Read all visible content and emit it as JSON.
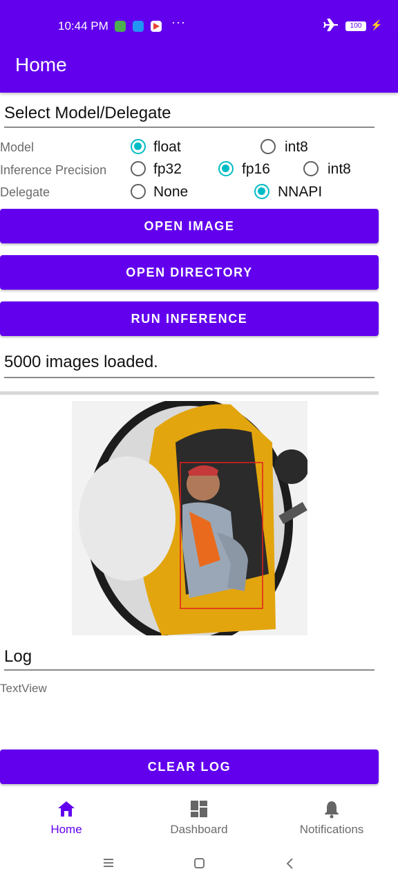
{
  "status_bar": {
    "time": "10:44 PM",
    "dots": "···",
    "battery": "100"
  },
  "appbar": {
    "title": "Home"
  },
  "model_section": {
    "title": "Select Model/Delegate",
    "rows": [
      {
        "label": "Model",
        "options": [
          {
            "label": "float",
            "selected": true
          },
          {
            "label": "int8",
            "selected": false
          }
        ]
      },
      {
        "label": "Inference Precision",
        "options": [
          {
            "label": "fp32",
            "selected": false
          },
          {
            "label": "fp16",
            "selected": true
          },
          {
            "label": "int8",
            "selected": false
          }
        ]
      },
      {
        "label": "Delegate",
        "options": [
          {
            "label": "None",
            "selected": false
          },
          {
            "label": "NNAPI",
            "selected": true
          }
        ]
      }
    ]
  },
  "buttons": {
    "open_image": "OPEN IMAGE",
    "open_directory": "OPEN DIRECTORY",
    "run_inference": "RUN INFERENCE",
    "clear_log": "CLEAR LOG"
  },
  "status_text": "5000 images loaded.",
  "log": {
    "title": "Log",
    "text": "TextView"
  },
  "bottom_nav": {
    "items": [
      {
        "label": "Home",
        "icon": "home-icon",
        "active": true
      },
      {
        "label": "Dashboard",
        "icon": "dashboard-icon",
        "active": false
      },
      {
        "label": "Notifications",
        "icon": "bell-icon",
        "active": false
      }
    ]
  },
  "colors": {
    "primary": "#6200ee",
    "radio_selected": "#00bcc4",
    "detection_box": "#e0201c"
  }
}
